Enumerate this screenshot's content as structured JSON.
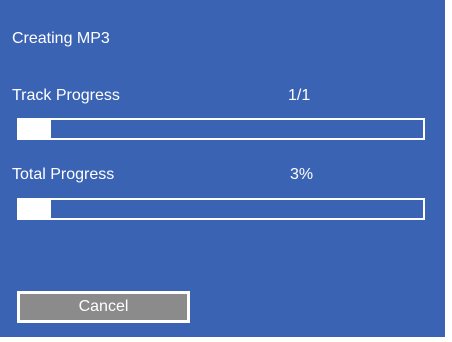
{
  "dialog": {
    "title": "Creating MP3",
    "track": {
      "label": "Track Progress",
      "value": "1/1",
      "fill": 0.08
    },
    "total": {
      "label": "Total Progress",
      "value": "3%",
      "fill": 0.08
    },
    "cancel_label": "Cancel"
  },
  "colors": {
    "background": "#3a63b4",
    "bar_fill": "#ffffff",
    "button": "#8b8b8b"
  }
}
